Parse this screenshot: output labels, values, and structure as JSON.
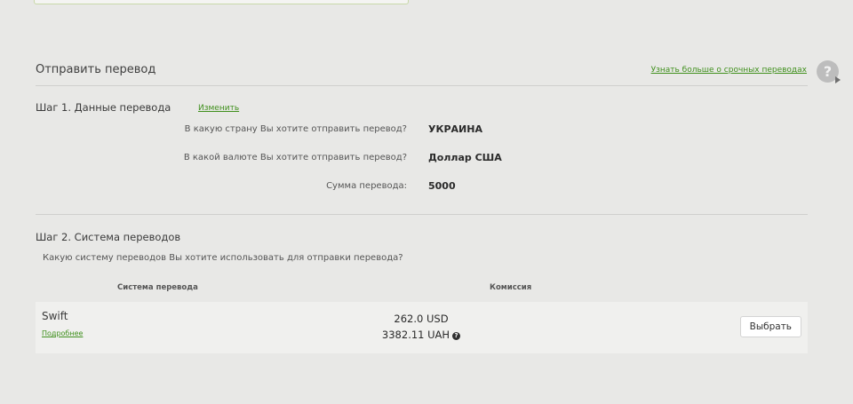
{
  "header": {
    "title": "Отправить перевод",
    "more_link": "Узнать больше о срочных переводах",
    "help_icon": "?"
  },
  "step1": {
    "title": "Шаг 1. Данные перевода",
    "change_link": "Изменить",
    "fields": [
      {
        "label": "В какую страну Вы хотите отправить перевод?",
        "value": "УКРАИНА"
      },
      {
        "label": "В какой валюте Вы хотите отправить перевод?",
        "value": "Доллар США"
      },
      {
        "label": "Сумма перевода:",
        "value": "5000"
      }
    ]
  },
  "step2": {
    "title": "Шаг 2. Система переводов",
    "question": "Какую систему переводов Вы хотите использовать для отправки перевода?",
    "columns": {
      "system": "Система перевода",
      "fee": "Комиссия"
    },
    "row": {
      "system_name": "Swift",
      "details_link": "Подробнее",
      "fee_usd": "262.0 USD",
      "fee_uah": "3382.11 UAH",
      "info_icon": "?",
      "choose_button": "Выбрать"
    }
  }
}
